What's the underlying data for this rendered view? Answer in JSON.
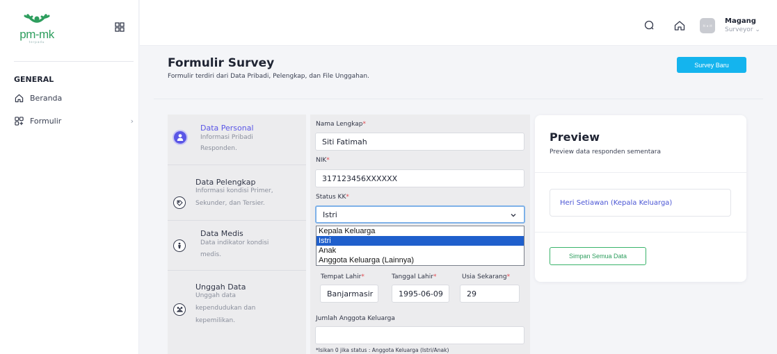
{
  "brand": {
    "logo_text": "pm-mk",
    "logo_sub": "terpadu"
  },
  "sidebar": {
    "section": "GENERAL",
    "items": [
      {
        "label": "Beranda",
        "icon": "home-icon"
      },
      {
        "label": "Formulir",
        "icon": "grid-icon"
      }
    ]
  },
  "topbar": {
    "avatar_text": "M ♦ M",
    "user_name": "Magang",
    "user_role": "Surveyor ⌄"
  },
  "page": {
    "title": "Formulir Survey",
    "description": "Formulir terdiri dari Data Pribadi, Pelengkap, dan File Unggahan.",
    "new_button": "Survey Baru"
  },
  "steps": [
    {
      "title": "Data Personal",
      "desc1": "Informasi Pribadi",
      "desc2": "Responden.",
      "desc3": "",
      "icon": "user-icon",
      "active": true
    },
    {
      "title": "Data Pelengkap",
      "desc1": "Informasi kondisi Primer,",
      "desc2": "Sekunder, dan Tersier.",
      "desc3": "",
      "icon": "tag-icon",
      "active": false
    },
    {
      "title": "Data Medis",
      "desc1": "Data indikator kondisi",
      "desc2": "medis.",
      "desc3": "",
      "icon": "medical-icon",
      "active": false
    },
    {
      "title": "Unggah Data",
      "desc1": "Unggah data",
      "desc2": "kependudukan dan",
      "desc3": "kepemilikan.",
      "icon": "people-icon",
      "active": false
    }
  ],
  "form": {
    "required_mark": "*",
    "nama_label": "Nama Lengkap",
    "nama_value": "Siti Fatimah",
    "nik_label": "NIK",
    "nik_value": "317123456XXXXXX",
    "status_label": "Status KK",
    "status_value": "Istri",
    "status_options": [
      "Kepala Keluarga",
      "Istri",
      "Anak",
      "Anggota Keluarga (Lainnya)"
    ],
    "tempat_label": "Tempat Lahir",
    "tempat_value": "Banjarmasir",
    "tanggal_label": "Tanggal Lahir",
    "tanggal_value": "1995-06-09",
    "usia_label": "Usia Sekarang",
    "usia_value": "29",
    "jumlah_label": "Jumlah Anggota Keluarga",
    "jumlah_value": "",
    "hint": "*Isikan 0 jika status : Anggota Keluarga (Istri/Anak)"
  },
  "preview": {
    "title": "Preview",
    "subtitle": "Preview data responden sementara",
    "item": "Heri Setiawan (Kepala Keluarga)",
    "save_button": "Simpan Semua Data"
  },
  "colors": {
    "brand_green": "#2e9e5e",
    "accent_blue": "#14b4ee",
    "active_purple": "#5a56e6",
    "required_red": "#e0484f"
  }
}
